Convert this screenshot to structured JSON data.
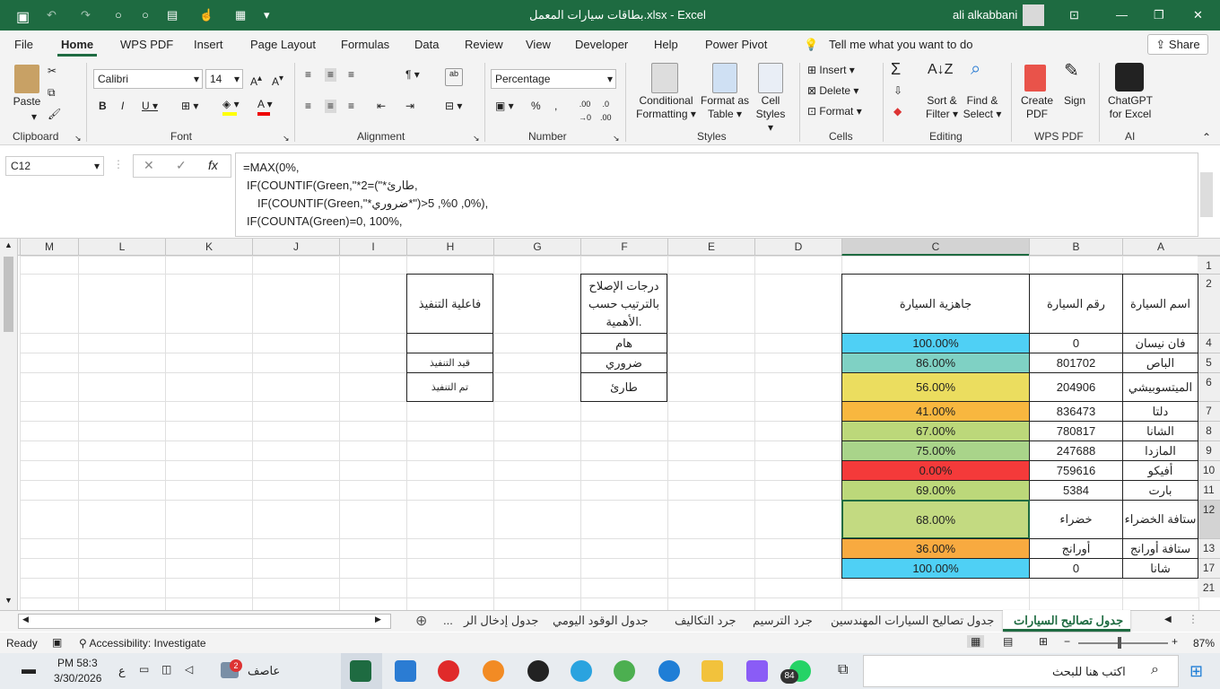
{
  "title_bar": {
    "filename": "بطاقات سيارات المعمل.xlsx",
    "app": "Excel",
    "user": "ali alkabbani"
  },
  "menu": [
    "File",
    "Home",
    "WPS PDF",
    "Insert",
    "Page Layout",
    "Formulas",
    "Data",
    "Review",
    "View",
    "Developer",
    "Help",
    "Power Pivot"
  ],
  "tell_me": "Tell me what you want to do",
  "share": "Share",
  "ribbon": {
    "paste": "Paste",
    "font_name": "Calibri",
    "font_size": "14",
    "number_format": "Percentage",
    "conditional": "Conditional",
    "formatting": "Formatting",
    "format_as": "Format as",
    "table": "Table",
    "cell": "Cell",
    "styles": "Styles",
    "insert": "Insert",
    "delete": "Delete",
    "format": "Format",
    "sort1": "Sort &",
    "sort2": "Filter",
    "find1": "Find &",
    "find2": "Select",
    "create1": "Create",
    "create2": "PDF",
    "sign": "Sign",
    "gpt1": "ChatGPT",
    "gpt2": "for Excel",
    "groups": {
      "clipboard": "Clipboard",
      "font": "Font",
      "alignment": "Alignment",
      "number": "Number",
      "styles": "Styles",
      "cells": "Cells",
      "editing": "Editing",
      "wpspdf": "WPS PDF",
      "ai": "AI"
    }
  },
  "namebox": "C12",
  "formula": [
    "=MAX(0%,",
    "IF(COUNTIF(Green,\"*2=(\"*طارئ,",
    "IF(COUNTIF(Green,\"*ضروري*\")>0, 0%, 5%),",
    "IF(COUNTA(Green)=0, 100%,"
  ],
  "columns": [
    "M",
    "L",
    "K",
    "J",
    "I",
    "H",
    "G",
    "F",
    "E",
    "D",
    "C",
    "B",
    "A"
  ],
  "rows": [
    "1",
    "2",
    "4",
    "5",
    "6",
    "7",
    "8",
    "9",
    "10",
    "11",
    "12",
    "13",
    "17",
    "21"
  ],
  "table": {
    "h_name": "اسم السيارة",
    "h_num": "رقم السيارة",
    "h_ready": "جاهزية السيارة",
    "rows": [
      {
        "name": "فان نيسان",
        "num": "0",
        "ready": "100.00%",
        "color": "#4fd0f5"
      },
      {
        "name": "الباص",
        "num": "801702",
        "ready": "86.00%",
        "color": "#7fd1c4"
      },
      {
        "name": "الميتسوبيشي",
        "num": "204906",
        "ready": "56.00%",
        "color": "#ebdd5f"
      },
      {
        "name": "دلتا",
        "num": "836473",
        "ready": "41.00%",
        "color": "#f8b73f"
      },
      {
        "name": "الشانا",
        "num": "780817",
        "ready": "67.00%",
        "color": "#bcd87a"
      },
      {
        "name": "المازدا",
        "num": "247688",
        "ready": "75.00%",
        "color": "#a9d48a"
      },
      {
        "name": "أفيكو",
        "num": "759616",
        "ready": "0.00%",
        "color": "#f43a3a"
      },
      {
        "name": "بارت",
        "num": "5384",
        "ready": "69.00%",
        "color": "#bcd87a"
      },
      {
        "name": "ستافة الخضراء",
        "num": "خضراء",
        "ready": "68.00%",
        "color": "#c3da81"
      },
      {
        "name": "ستافة أورانج",
        "num": "أورانج",
        "ready": "36.00%",
        "color": "#f8aa40"
      },
      {
        "name": "شانا",
        "num": "0",
        "ready": "100.00%",
        "color": "#4fd0f5"
      }
    ]
  },
  "repair": {
    "header": "درجات الإصلاح بالترتيب حسب الأهمية.",
    "items": [
      "هام",
      "ضروري",
      "طارئ"
    ]
  },
  "exec": {
    "header": "فاعلية التنفيذ",
    "items": [
      "",
      "قيد التنفيذ",
      "تم التنفيذ"
    ]
  },
  "sheets": [
    "جدول تصاليح السيارات",
    "جدول تصاليح السيارات المهندسين",
    "جرد الترسيم",
    "جرد التكاليف",
    "جدول الوقود اليومي",
    "جدول إدخال الر",
    "..."
  ],
  "status": {
    "ready": "Ready",
    "accessibility": "Accessibility: Investigate",
    "zoom": "87%"
  },
  "taskbar": {
    "time": "PM 58:3",
    "date": "3/30/2026",
    "search": "اكتب هنا للبحث",
    "user": "عاصف",
    "badge": "2",
    "badge2": "84",
    "lang": "ع"
  }
}
